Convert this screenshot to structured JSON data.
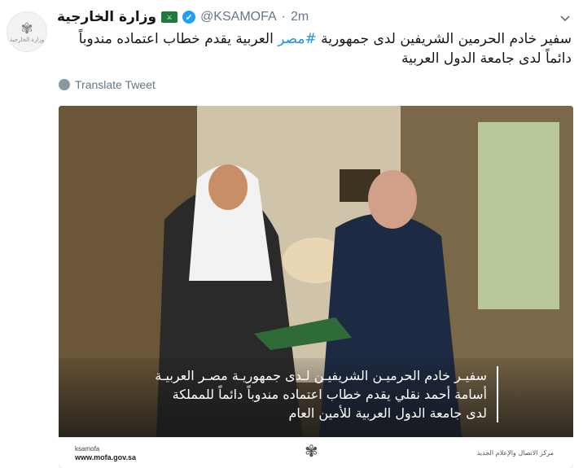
{
  "account": {
    "display_name": "وزارة الخارجية",
    "handle": "@KSAMOFA",
    "separator": "·",
    "time": "2m",
    "avatar_caption": "وزارة الخارجية"
  },
  "tweet": {
    "text_before": "سفير خادم الحرمين الشريفين لدى جمهورية ",
    "hashtag": "#مصر",
    "text_after": " العربية يقدم خطاب اعتماده مندوباً دائماً لدى جامعة الدول العربية"
  },
  "translate_label": "Translate Tweet",
  "media": {
    "caption_lines": [
      "سفيـر خادم الحرميـن الشريفيـن لـدى جمهوريـة مصـر العربيـة",
      "أسامة أحمد نقلي يقدم خطاب اعتماده مندوباً دائماً للمملكة",
      "لدى جامعة الدول العربية للأمين العام"
    ],
    "footer_handle": "ksamofa",
    "footer_url": "www.mofa.gov.sa",
    "footer_right": "مركز الاتصال والإعلام الجديد"
  },
  "icons": {
    "flag": "saudi-flag-icon",
    "verified": "verified-badge-icon",
    "translate": "globe-icon",
    "menu": "chevron-down-icon"
  },
  "colors": {
    "link": "#1b95e0",
    "verified": "#1da1f2",
    "meta": "#657786"
  }
}
